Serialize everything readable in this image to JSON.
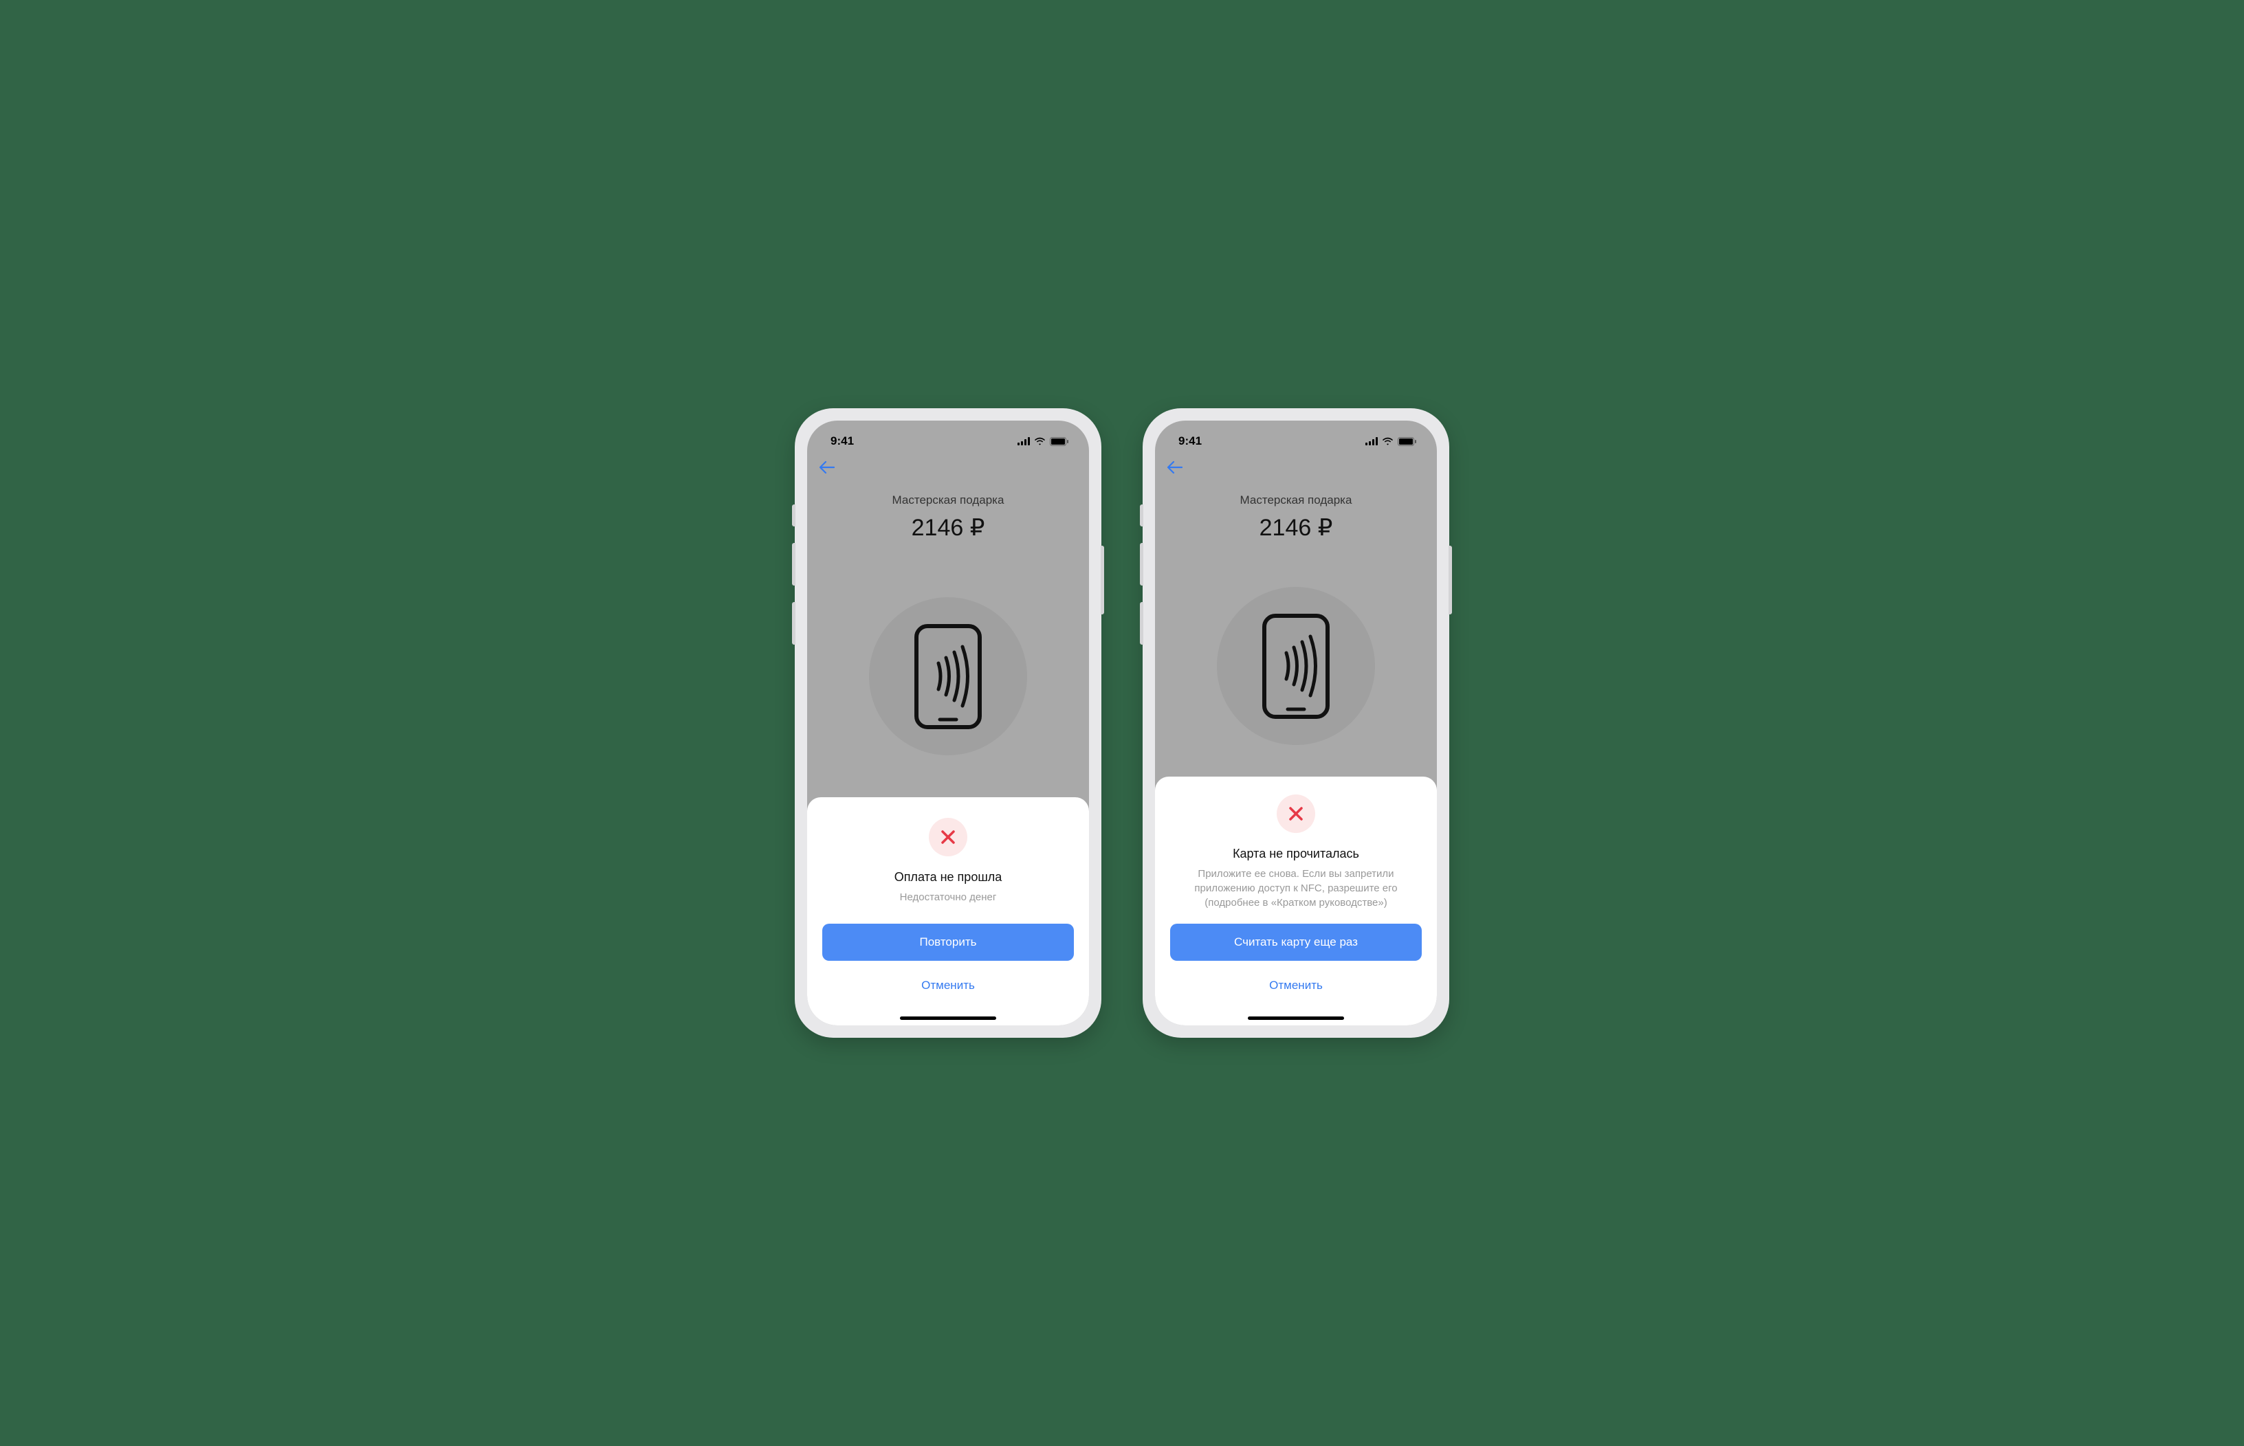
{
  "status": {
    "time": "9:41"
  },
  "screens": [
    {
      "merchant": "Мастерская подарка",
      "amount": "2146 ₽",
      "error_title": "Оплата не прошла",
      "error_subtitle": "Недостаточно денег",
      "primary_button": "Повторить",
      "secondary_button": "Отменить"
    },
    {
      "merchant": "Мастерская подарка",
      "amount": "2146 ₽",
      "error_title": "Карта не прочиталась",
      "error_subtitle": "Приложите ее снова. Если вы запретили приложению доступ к NFC, разрешите его (подробнее в «Кратком руководстве»)",
      "primary_button": "Считать карту еще раз",
      "secondary_button": "Отменить"
    }
  ]
}
